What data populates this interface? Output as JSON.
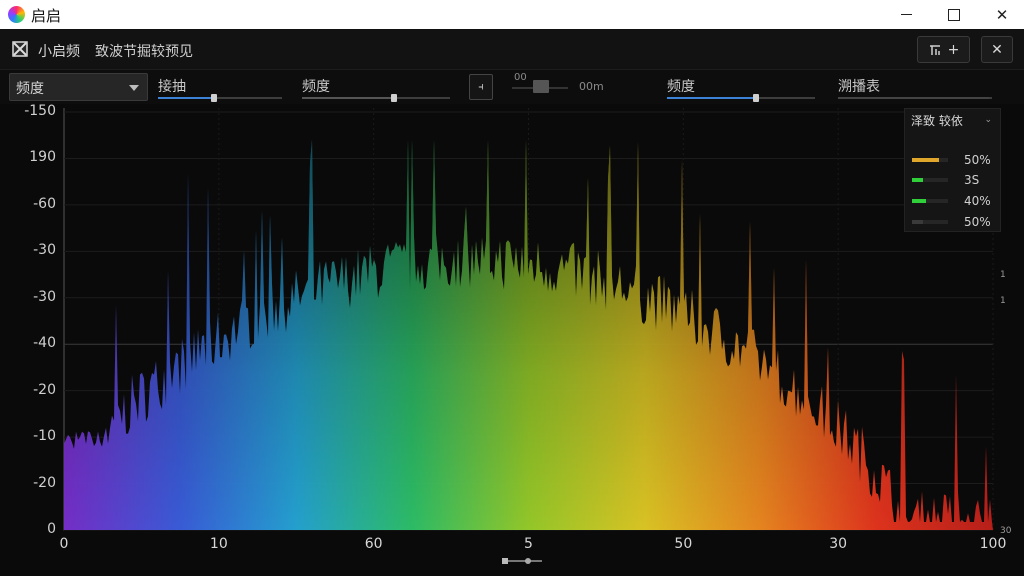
{
  "window": {
    "title": "启启",
    "buttons": [
      "minimize",
      "maximize",
      "close"
    ]
  },
  "header": {
    "app_name": "小启频",
    "subtitle": "致波节掘较预见",
    "add_label": "+",
    "close_label": "✕"
  },
  "controls": {
    "mode_select": {
      "value": "频度"
    },
    "slider1": {
      "label": "接抽",
      "level": 0.45
    },
    "slider2": {
      "label": "频度",
      "level": 0.62
    },
    "toggle_small_label": "00",
    "toggle_unit": "00m",
    "slider3": {
      "label": "频度",
      "level": 0.6
    },
    "slider4": {
      "label": "溯播表",
      "level": 0.98
    }
  },
  "chart_data": {
    "type": "area",
    "y_ticks": [
      "-150",
      "190",
      "-60",
      "-30",
      "-30",
      "-40",
      "-20",
      "-10",
      "-20",
      "0"
    ],
    "x_ticks": [
      "0",
      "10",
      "60",
      "5",
      "50",
      "30",
      "100"
    ],
    "right_ticks": [
      "1",
      "1",
      "30"
    ],
    "grid": true,
    "gradient_colors": [
      "#7a2fd0",
      "#3b5fe0",
      "#25a7d8",
      "#2ec46a",
      "#9ad02a",
      "#e3cc25",
      "#f08a20",
      "#e8351e",
      "#c0201a"
    ]
  },
  "legend": {
    "title": "泽致 较依",
    "rows": [
      {
        "value": "50%",
        "color": "#e0a62b",
        "fill": 0.75
      },
      {
        "value": "3S",
        "color": "#2fd03a",
        "fill": 0.3
      },
      {
        "value": "40%",
        "color": "#2fd03a",
        "fill": 0.4
      },
      {
        "value": "50%",
        "color": "#3a3a3a",
        "fill": 0.3
      }
    ]
  }
}
